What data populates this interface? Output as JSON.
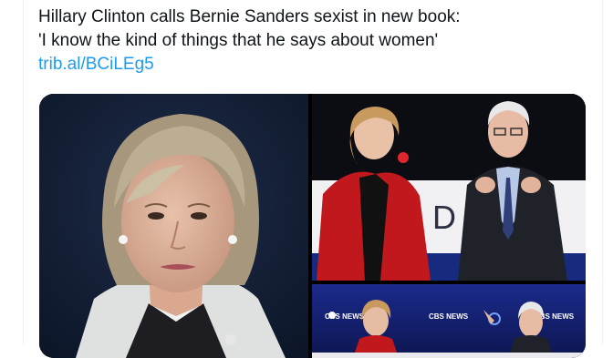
{
  "tweet": {
    "text_line1": "Hillary Clinton calls Bernie Sanders sexist in new book:",
    "text_line2": "'I know the kind of things that he says about women'",
    "link": "trib.al/BCiLEg5"
  },
  "media": {
    "image_count": 3,
    "photos": [
      {
        "subject": "portrait-woman-gray-jacket"
      },
      {
        "subject": "debate-stage-two-candidates",
        "backdrop_text": "D"
      },
      {
        "subject": "debate-stage-news-logos",
        "logo_texts": [
          "CBS NEWS",
          "CBS NEWS",
          "CBS NEWS"
        ]
      }
    ]
  },
  "colors": {
    "link": "#1d9bf0",
    "text": "#0f1419",
    "red_coat": "#c0181c",
    "navy_bg": "#141f33"
  }
}
